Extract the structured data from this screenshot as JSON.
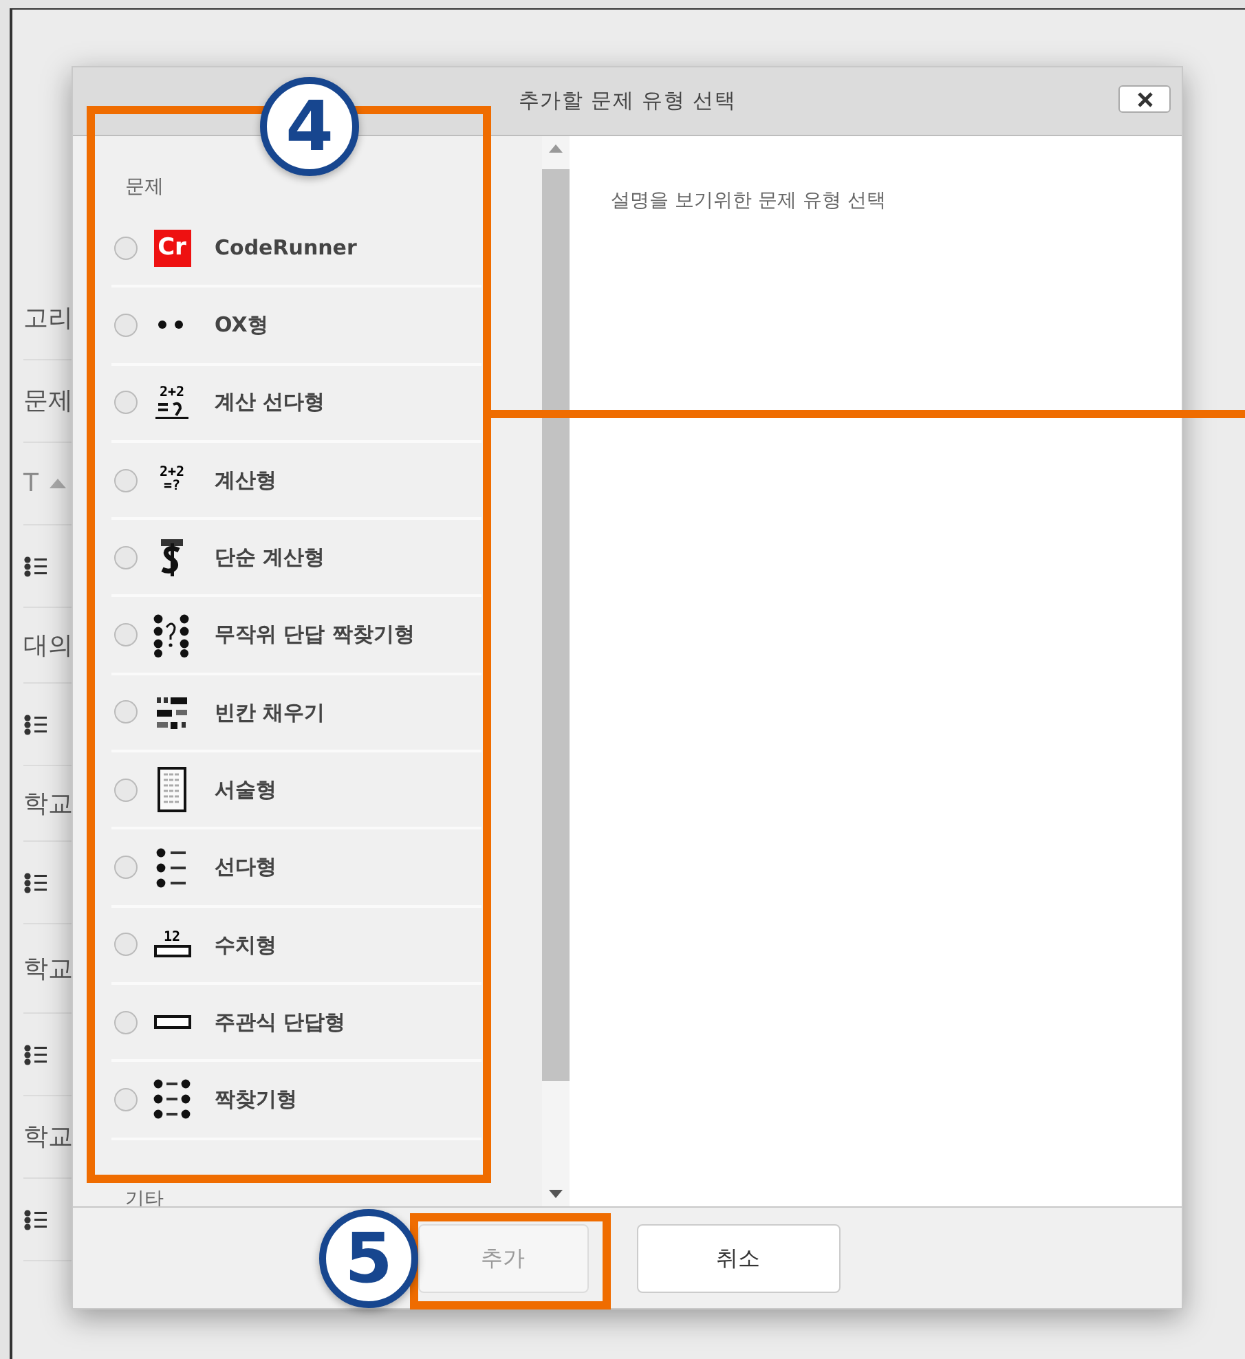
{
  "background": {
    "items": [
      {
        "kind": "text",
        "text": "고리"
      },
      {
        "kind": "text",
        "text": "문제"
      },
      {
        "kind": "sort",
        "text": "T"
      },
      {
        "kind": "list-icon"
      },
      {
        "kind": "text",
        "text": "대의"
      },
      {
        "kind": "list-icon"
      },
      {
        "kind": "text",
        "text": "학교"
      },
      {
        "kind": "list-icon"
      },
      {
        "kind": "text",
        "text": "학교"
      },
      {
        "kind": "list-icon"
      },
      {
        "kind": "text",
        "text": "학교"
      },
      {
        "kind": "list-icon"
      }
    ]
  },
  "dialog": {
    "title": "추가할 문제 유형 선택",
    "description": "설명을 보기위한 문제 유형 선택",
    "sections": [
      {
        "heading": "문제",
        "items": [
          {
            "kind": "coderunner",
            "label": "CodeRunner",
            "icon_text": "Cr",
            "selected": false
          },
          {
            "kind": "truefalse",
            "label": "OX형",
            "selected": false
          },
          {
            "kind": "calcmulti",
            "label": "계산 선다형",
            "icon_text": "2+2",
            "selected": false
          },
          {
            "kind": "calc",
            "label": "계산형",
            "icon_text": "2+2",
            "icon_text_2": "=?",
            "selected": false
          },
          {
            "kind": "calcsimple",
            "label": "단순 계산형",
            "selected": false
          },
          {
            "kind": "randommatch",
            "label": "무작위 단답 짝찾기형",
            "selected": false
          },
          {
            "kind": "gapfill",
            "label": "빈칸 채우기",
            "selected": false
          },
          {
            "kind": "essay",
            "label": "서술형",
            "selected": false
          },
          {
            "kind": "multichoice",
            "label": "선다형",
            "selected": false
          },
          {
            "kind": "numerical",
            "label": "수치형",
            "icon_text": "12",
            "selected": false
          },
          {
            "kind": "shortanswer",
            "label": "주관식 단답형",
            "selected": false
          },
          {
            "kind": "match",
            "label": "짝찾기형",
            "selected": false
          }
        ]
      },
      {
        "heading": "기타"
      }
    ],
    "buttons": [
      {
        "label": "추가",
        "disabled": true
      },
      {
        "label": "취소",
        "disabled": false
      }
    ]
  },
  "annotations": [
    {
      "label": "4"
    },
    {
      "label": "5"
    }
  ]
}
